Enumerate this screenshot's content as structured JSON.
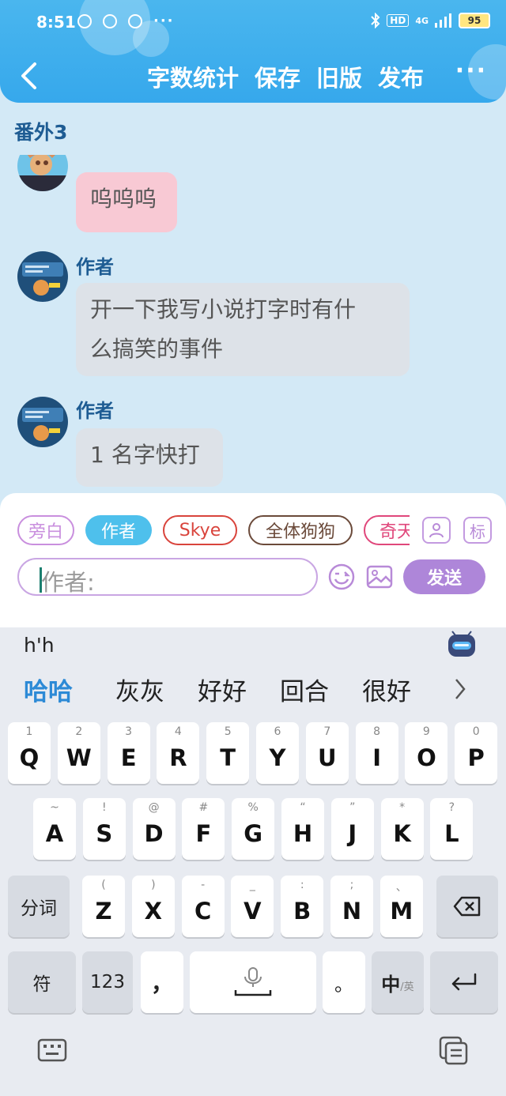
{
  "status": {
    "time": "8:51",
    "network": "4G",
    "hd": "HD",
    "battery": "95"
  },
  "nav": {
    "actions": [
      "字数统计",
      "保存",
      "旧版",
      "发布"
    ],
    "more": "···"
  },
  "chapter_title": "番外3",
  "messages": [
    {
      "sender": "",
      "text": "呜呜呜",
      "style": "pink"
    },
    {
      "sender": "作者",
      "text_lines": [
        "开一下我写小说打字时有什",
        "么搞笑的事件"
      ],
      "style": "gray"
    },
    {
      "sender": "作者",
      "text": "1 名字快打",
      "style": "gray"
    }
  ],
  "roles": [
    {
      "label": "旁白",
      "color": "#c98fde"
    },
    {
      "label": "作者",
      "color": "#ffffff"
    },
    {
      "label": "Skye",
      "color": "#d9443c"
    },
    {
      "label": "全体狗狗",
      "color": "#6b4a3a"
    },
    {
      "label": "奇天",
      "color": "#e0477b"
    }
  ],
  "role_side": {
    "tag_label": "标"
  },
  "input": {
    "placeholder": "作者:",
    "send_label": "发送"
  },
  "keyboard": {
    "composing": "h'h",
    "candidates": [
      "哈哈",
      "灰灰",
      "好好",
      "回合",
      "很好"
    ],
    "row1": [
      {
        "k": "Q",
        "s": "1"
      },
      {
        "k": "W",
        "s": "2"
      },
      {
        "k": "E",
        "s": "3"
      },
      {
        "k": "R",
        "s": "4"
      },
      {
        "k": "T",
        "s": "5"
      },
      {
        "k": "Y",
        "s": "6"
      },
      {
        "k": "U",
        "s": "7"
      },
      {
        "k": "I",
        "s": "8"
      },
      {
        "k": "O",
        "s": "9"
      },
      {
        "k": "P",
        "s": "0"
      }
    ],
    "row2": [
      {
        "k": "A",
        "s": "~"
      },
      {
        "k": "S",
        "s": "!"
      },
      {
        "k": "D",
        "s": "@"
      },
      {
        "k": "F",
        "s": "#"
      },
      {
        "k": "G",
        "s": "%"
      },
      {
        "k": "H",
        "s": "“"
      },
      {
        "k": "J",
        "s": "”"
      },
      {
        "k": "K",
        "s": "*"
      },
      {
        "k": "L",
        "s": "?"
      }
    ],
    "row3": [
      {
        "k": "Z",
        "s": "("
      },
      {
        "k": "X",
        "s": ")"
      },
      {
        "k": "C",
        "s": "-"
      },
      {
        "k": "V",
        "s": "_"
      },
      {
        "k": "B",
        "s": ":"
      },
      {
        "k": "N",
        "s": ";"
      },
      {
        "k": "M",
        "s": "、"
      }
    ],
    "fenci": "分词",
    "fu": "符",
    "num": "123",
    "comma": "，",
    "period": "。",
    "lang_main": "中",
    "lang_sub": "/英"
  }
}
